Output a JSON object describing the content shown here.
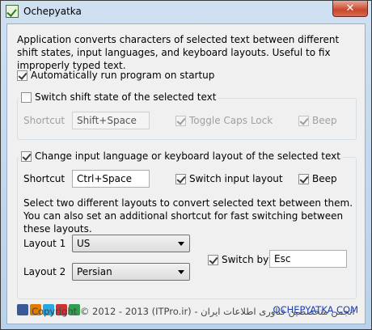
{
  "window": {
    "title": "Ochepyatka",
    "close_glyph": "✕"
  },
  "description": "Application converts characters of selected text between different shift states, input languages, and keyboard layouts. Useful to fix improperly typed text.",
  "autorun": {
    "label": "Automatically run program on startup",
    "checked": true
  },
  "shift_group": {
    "label": "Switch shift state of the selected text",
    "checked": false,
    "shortcut_label": "Shortcut",
    "shortcut_value": "Shift+Space",
    "caps_label": "Toggle Caps Lock",
    "beep_label": "Beep"
  },
  "layout_group": {
    "label": "Change input language or keyboard layout of the selected text",
    "checked": true,
    "shortcut_label": "Shortcut",
    "shortcut_value": "Ctrl+Space",
    "switch_input_label": "Switch input layout",
    "beep_label": "Beep",
    "hint": "Select two different layouts to convert selected text between them. You can also set an additional shortcut for fast switching between these layouts.",
    "layout1_label": "Layout 1",
    "layout1_value": "US",
    "layout2_label": "Layout 2",
    "layout2_value": "Persian",
    "switch_by_label": "Switch by",
    "switch_by_value": "Esc"
  },
  "footer": {
    "copyright": "Copyright © 2012 - 2013 (ITPro.ir) - انجمن متخصصین فناوری اطلاعات ایران",
    "link": "OCHEPYATKA.COM"
  }
}
